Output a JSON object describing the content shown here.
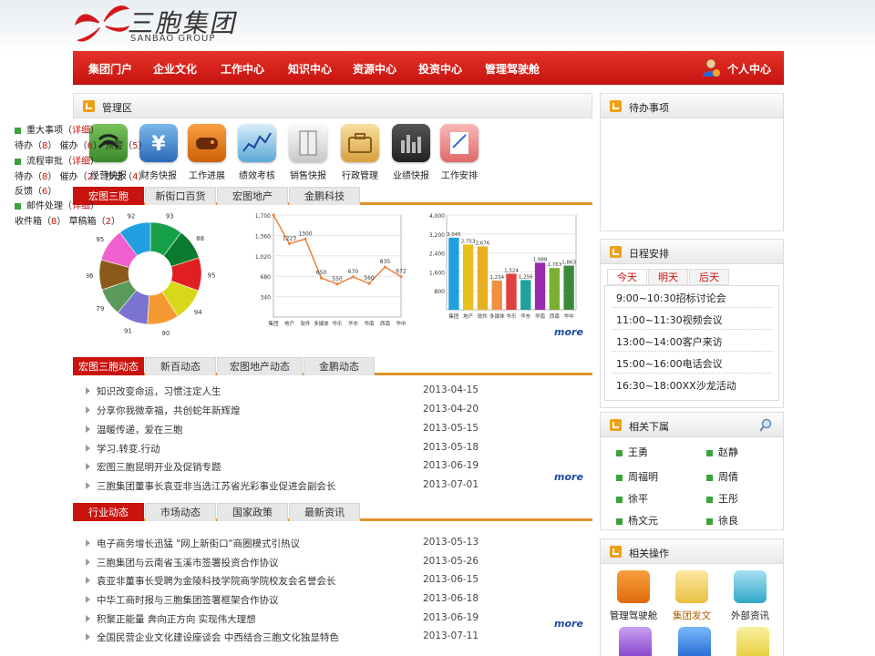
{
  "header": {
    "logo_cn": "三胞集团",
    "logo_en": "SANBAO GROUP"
  },
  "nav": {
    "items": [
      "集团门户",
      "企业文化",
      "工作中心",
      "知识中心",
      "资源中心",
      "投资中心",
      "管理驾驶舱"
    ],
    "user": "个人中心"
  },
  "manage": {
    "title": "管理区",
    "apps": [
      {
        "label": "经营快报",
        "icon": "signal-icon"
      },
      {
        "label": "财务快报",
        "icon": "yen-icon"
      },
      {
        "label": "工作进展",
        "icon": "gamepad-icon"
      },
      {
        "label": "绩效考核",
        "icon": "stock-chart-icon"
      },
      {
        "label": "销售快报",
        "icon": "file-cabinet-icon"
      },
      {
        "label": "行政管理",
        "icon": "briefcase-icon"
      },
      {
        "label": "业绩快报",
        "icon": "equalizer-icon"
      },
      {
        "label": "工作安排",
        "icon": "notepad-icon"
      }
    ],
    "tabs": [
      "宏图三胞",
      "新街口百货",
      "宏图地产",
      "金鹏科技"
    ]
  },
  "chart_data": [
    {
      "type": "pie",
      "categories": [
        "",
        "",
        "",
        "",
        "",
        "",
        "",
        "",
        "",
        ""
      ],
      "values": [
        93,
        88,
        95,
        94,
        90,
        91,
        79,
        86,
        95,
        92
      ],
      "colors": [
        "#16a04a",
        "#0b7a2e",
        "#e02020",
        "#d8d81a",
        "#f59a32",
        "#7b73d0",
        "#5a9a5a",
        "#8b5a1a",
        "#f060d0",
        "#20a0e0"
      ]
    },
    {
      "type": "line",
      "categories": [
        "集团",
        "地产",
        "软件",
        "多媒体",
        "华乐",
        "华东",
        "华南",
        "西南",
        "华中"
      ],
      "values": [
        1700,
        1223,
        1300,
        650,
        550,
        670,
        560,
        835,
        672
      ],
      "ylim": [
        0,
        1700
      ],
      "yticks": [
        "1,700",
        "1,360",
        "1,020",
        "680",
        "340"
      ],
      "grid": true
    },
    {
      "type": "bar",
      "categories": [
        "集团",
        "地产",
        "软件",
        "多媒体",
        "华乐",
        "华东",
        "华南",
        "西南",
        "华中"
      ],
      "values": [
        3045,
        2753,
        2676,
        1234,
        1524,
        1256,
        1988,
        1763,
        1863
      ],
      "labels": [
        "3,045",
        "2,753",
        "2,676",
        "1,234",
        "1,524",
        "1,256",
        "1,988",
        "1,763",
        "1,863"
      ],
      "colors": [
        "#20a0e0",
        "#e8c020",
        "#e8b020",
        "#f09040",
        "#e04040",
        "#20a0a0",
        "#9a2ab0",
        "#7ab030",
        "#3a8a3a"
      ],
      "ylim": [
        0,
        4000
      ],
      "yticks": [
        "4,000",
        "3,200",
        "2,400",
        "1,600",
        "800"
      ],
      "grid": true
    }
  ],
  "more": "more",
  "dynamics": {
    "tabs": [
      "宏图三胞动态",
      "新百动态",
      "宏图地产动态",
      "金鹏动态"
    ],
    "items": [
      {
        "title": "知识改变命运，习惯注定人生",
        "date": "2013-04-15"
      },
      {
        "title": "分享你我微幸福，共创蛇年新辉煌",
        "date": "2013-04-20"
      },
      {
        "title": "温暖传递，爱在三胞",
        "date": "2013-05-15"
      },
      {
        "title": "学习.转变.行动",
        "date": "2013-05-18"
      },
      {
        "title": "宏图三胞昆明开业及促销专题",
        "date": "2013-06-19"
      },
      {
        "title": "三胞集团董事长袁亚非当选江苏省光彩事业促进会副会长",
        "date": "2013-07-01"
      }
    ]
  },
  "industry": {
    "tabs": [
      "行业动态",
      "市场动态",
      "国家政策",
      "最新资讯"
    ],
    "items": [
      {
        "title": "电子商务增长迅猛 \"网上新街口\"商圈模式引热议",
        "date": "2013-05-13"
      },
      {
        "title": "三胞集团与云南省玉溪市签署投资合作协议",
        "date": "2013-05-26"
      },
      {
        "title": "袁亚非董事长受聘为金陵科技学院商学院校友会名誉会长",
        "date": "2013-06-15"
      },
      {
        "title": "中华工商时报与三胞集团签署框架合作协议",
        "date": "2013-06-18"
      },
      {
        "title": "积聚正能量 奔向正方向 实现伟大理想",
        "date": "2013-06-19"
      },
      {
        "title": "全国民营企业文化建设座谈会 中西结合三胞文化独显特色",
        "date": "2013-07-11"
      }
    ]
  },
  "todo": {
    "title": "待办事项",
    "detail": "详细",
    "sections": [
      {
        "name": "重大事项",
        "counts": [
          {
            "k": "待办",
            "v": "8"
          },
          {
            "k": "催办",
            "v": "6"
          },
          {
            "k": "预警",
            "v": "5"
          }
        ]
      },
      {
        "name": "流程审批",
        "counts": [
          {
            "k": "待办",
            "v": "8"
          },
          {
            "k": "催办",
            "v": "2"
          },
          {
            "k": "抄送",
            "v": "4"
          },
          {
            "k": "反馈",
            "v": "6"
          }
        ]
      },
      {
        "name": "邮件处理",
        "counts": [
          {
            "k": "收件箱",
            "v": "8"
          },
          {
            "k": "草稿箱",
            "v": "2"
          }
        ]
      }
    ]
  },
  "schedule": {
    "title": "日程安排",
    "tabs": [
      "今天",
      "明天",
      "后天"
    ],
    "items": [
      "9:00~10:30招标讨论会",
      "11:00~11:30视频会议",
      "13:00~14:00客户来访",
      "15:00~16:00电话会议",
      "16:30~18:00XX沙龙活动"
    ]
  },
  "staff": {
    "title": "相关下属",
    "people": [
      "王勇",
      "赵静",
      "周福明",
      "周倩",
      "徐平",
      "王彤",
      "杨文元",
      "徐良"
    ]
  },
  "ops": {
    "title": "相关操作",
    "items": [
      {
        "label": "管理驾驶舱",
        "icon": "dashboard-icon"
      },
      {
        "label": "集团发文",
        "icon": "document-icon"
      },
      {
        "label": "外部资讯",
        "icon": "news-icon"
      }
    ]
  }
}
